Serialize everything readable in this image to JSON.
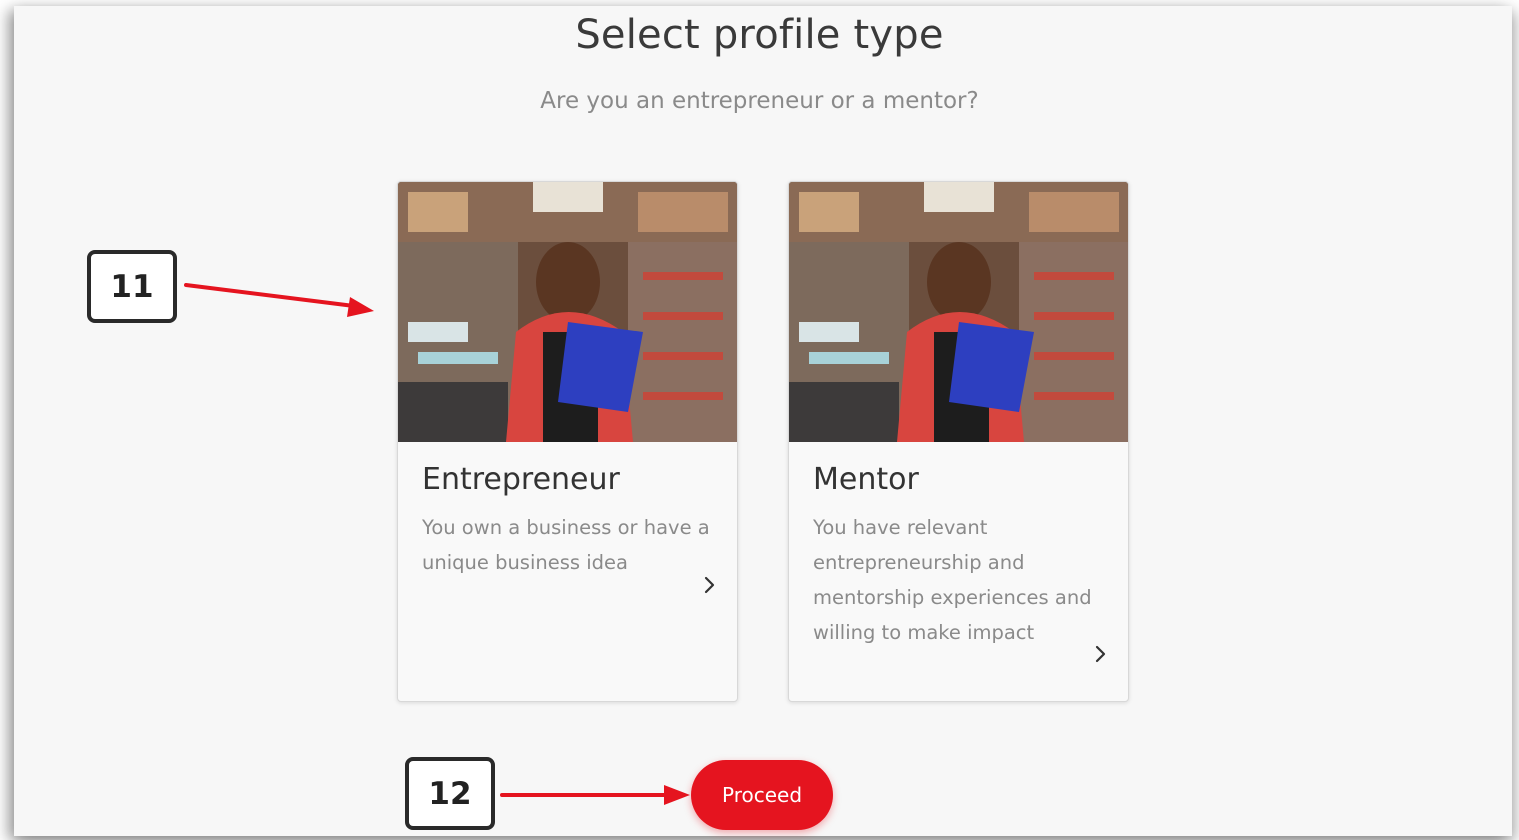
{
  "header": {
    "title": "Select profile type",
    "subtitle": "Are you an entrepreneur or a mentor?"
  },
  "cards": [
    {
      "title": "Entrepreneur",
      "description": "You own a business or have a unique business idea",
      "photo_icon": "shopkeeper-photo",
      "chevron_icon": "chevron-right-icon"
    },
    {
      "title": "Mentor",
      "description": "You have relevant entrepreneurship and mentorship experiences and willing to make impact",
      "photo_icon": "shopkeeper-photo",
      "chevron_icon": "chevron-right-icon"
    }
  ],
  "annotations": {
    "step_11": "11",
    "step_12": "12",
    "arrow_color": "#e5141f"
  },
  "actions": {
    "proceed_label": "Proceed",
    "accent": "#e5141f"
  }
}
